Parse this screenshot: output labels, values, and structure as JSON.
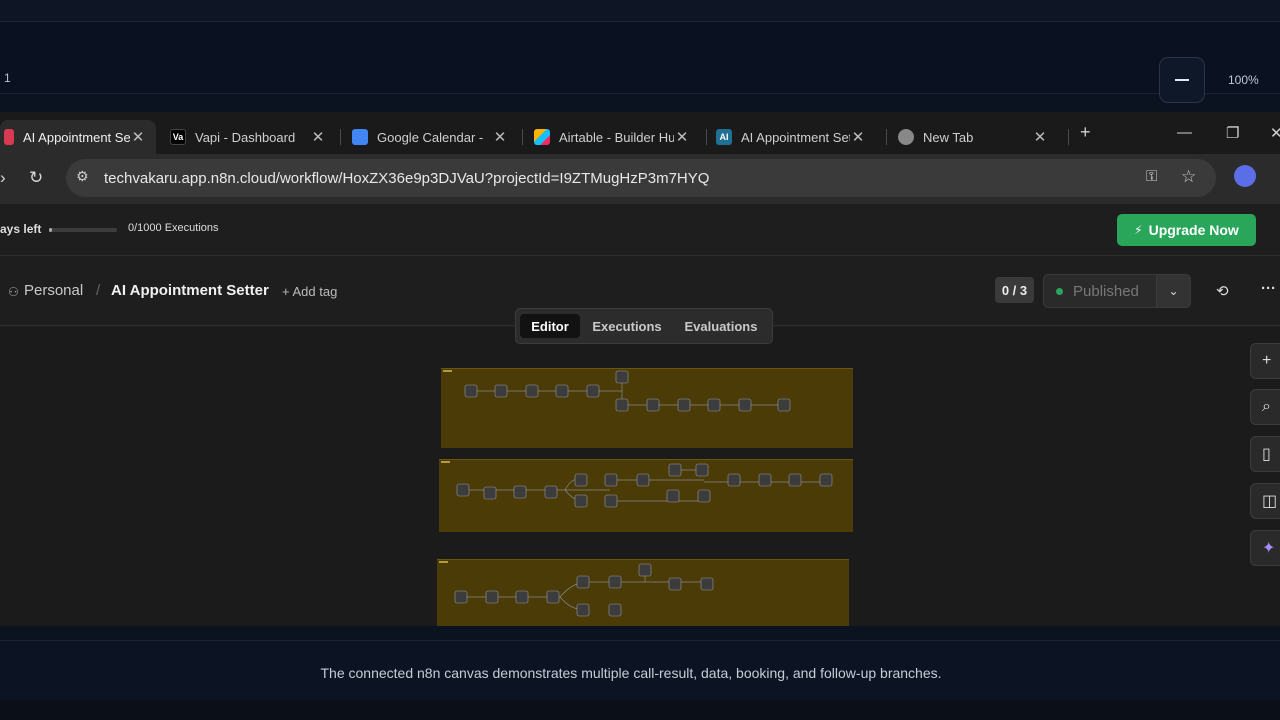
{
  "presentation": {
    "page_number": "1",
    "zoom_level": "100%",
    "caption": "The connected n8n canvas demonstrates multiple call-result, data, booking, and follow-up branches."
  },
  "browser": {
    "tabs": [
      {
        "title": "AI Appointment Setter",
        "favicon": "n8n-icon",
        "active": true
      },
      {
        "title": "Vapi - Dashboard",
        "favicon": "vapi-icon",
        "active": false
      },
      {
        "title": "Google Calendar - ",
        "favicon": "google-calendar-icon",
        "active": false
      },
      {
        "title": "Airtable - Builder Hub",
        "favicon": "airtable-icon",
        "active": false
      },
      {
        "title": "AI Appointment Setter",
        "favicon": "ai-icon",
        "active": false
      },
      {
        "title": "New Tab",
        "favicon": "chrome-icon",
        "active": false
      }
    ],
    "url": "techvakaru.app.n8n.cloud/workflow/HoxZX36e9p3DJVaU?projectId=I9ZTMugHzP3m7HYQ"
  },
  "n8n": {
    "trial": {
      "days_left_label": "ays left",
      "progress": 0.05,
      "executions": "0/1000 Executions"
    },
    "upgrade_label": "Upgrade Now",
    "breadcrumb": {
      "project": "Personal",
      "separator": "/",
      "workflow": "AI Appointment Setter"
    },
    "add_tag_label": "+ Add tag",
    "counter": "0 / 3",
    "publish_label": "Published",
    "view_tabs": [
      {
        "label": "Editor",
        "active": true
      },
      {
        "label": "Executions",
        "active": false
      },
      {
        "label": "Evaluations",
        "active": false
      }
    ],
    "sticky_color": "#4a3b07",
    "canvas_tools": [
      "plus-icon",
      "search-icon",
      "sticky-note-icon",
      "panel-icon",
      "ai-sparkle-icon"
    ]
  }
}
